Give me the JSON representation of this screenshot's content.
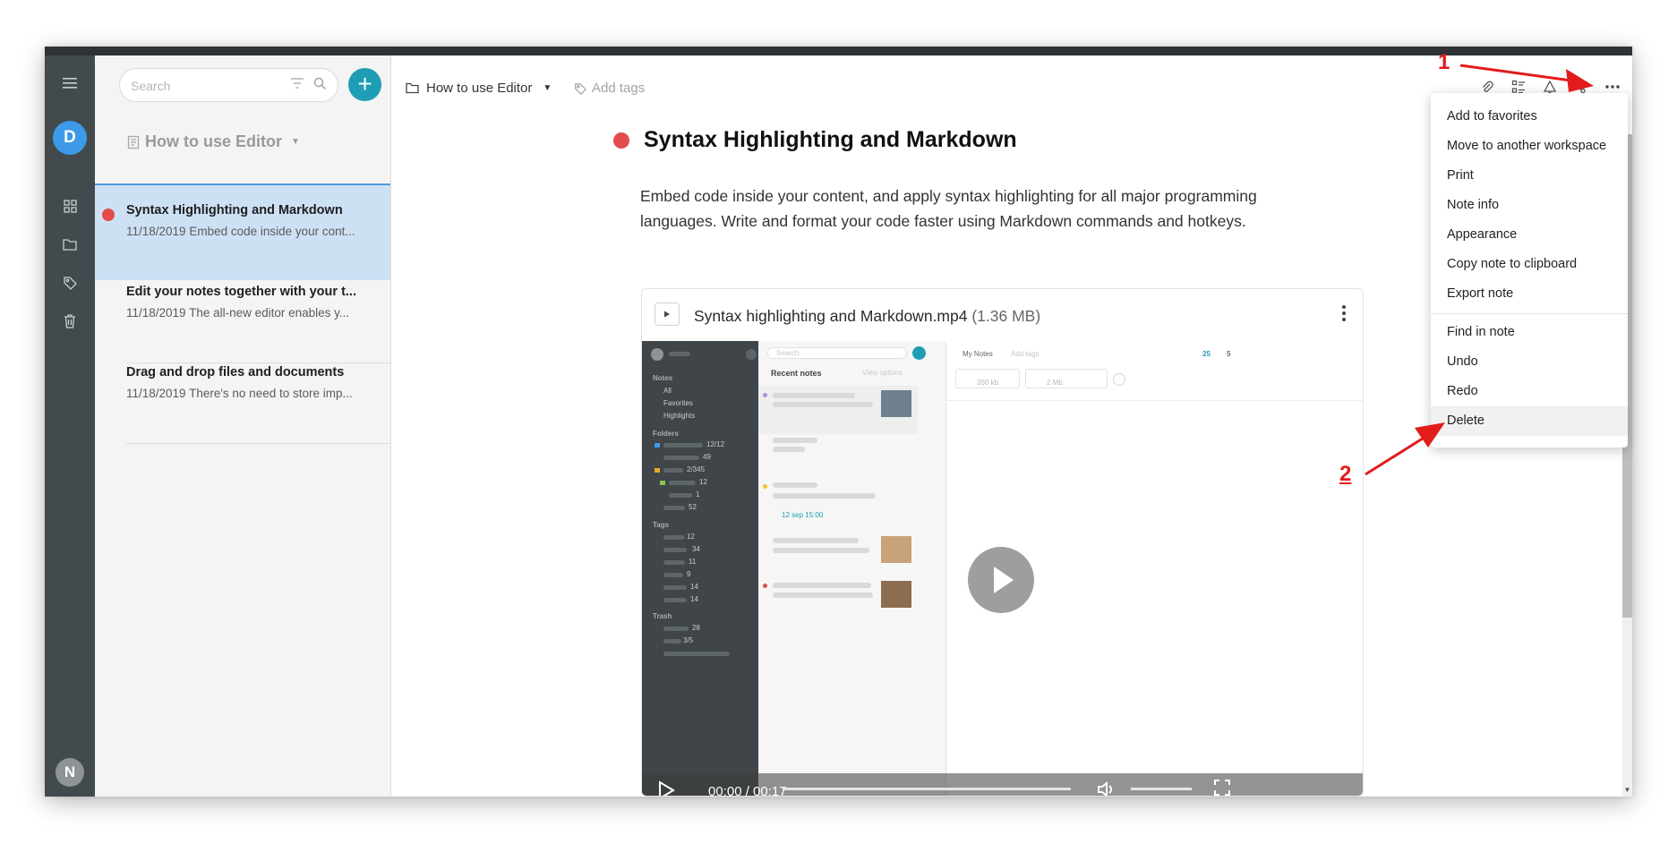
{
  "notelist": {
    "search_placeholder": "Search",
    "notebook_title": "How to use Editor",
    "notes": [
      {
        "title": "Syntax Highlighting and Markdown",
        "subtitle": "11/18/2019 Embed code inside your cont..."
      },
      {
        "title": "Edit your notes together with your t...",
        "subtitle": "11/18/2019 The all-new editor enables y..."
      },
      {
        "title": "Drag and drop files and documents",
        "subtitle": "11/18/2019 There's no need to store imp..."
      }
    ]
  },
  "rail": {
    "avatar_top": "D",
    "avatar_bottom": "N"
  },
  "editor": {
    "breadcrumb": "How to use Editor",
    "add_tags": "Add tags",
    "title": "Syntax Highlighting and Markdown",
    "body": "Embed code inside your content, and apply syntax highlighting for all major programming languages. Write and format your code faster using Markdown commands and hotkeys."
  },
  "attachment": {
    "file_name": "Syntax highlighting and Markdown.mp4",
    "file_size": "(1.36 MB)",
    "time": "00:00 / 00:17",
    "preview": {
      "search": "Search",
      "recent_notes": "Recent notes",
      "view_options": "View options",
      "my_notes": "My Notes",
      "add_tags": "Add tags",
      "notes_heading": "Notes",
      "all": "All",
      "favorites": "Favorites",
      "highlights": "Highlights",
      "folders_heading": "Folders",
      "tags_heading": "Tags",
      "trash_heading": "Trash",
      "count_a": "25",
      "count_b": "5",
      "file_a_size": "350 kb",
      "file_b_size": "2 Mb",
      "reminder": "12 sep 15:00",
      "folder_counts": [
        "12/12",
        "49",
        "2/345",
        "12",
        "1",
        "52"
      ],
      "tag_counts": [
        "12",
        "34",
        "11",
        "9",
        "14",
        "14"
      ],
      "trash_counts": [
        "28",
        "3/5"
      ]
    }
  },
  "menu": {
    "items_group1": [
      "Add to favorites",
      "Move to another workspace",
      "Print",
      "Note info",
      "Appearance",
      "Copy note to clipboard",
      "Export note"
    ],
    "items_group2": [
      "Find in note",
      "Undo",
      "Redo",
      "Delete"
    ]
  },
  "annotations": {
    "label_1": "1",
    "label_2": "2",
    "color": "#e31b1b"
  },
  "colors": {
    "accent": "#1e9db5",
    "selected_note_bg": "#cde1f5",
    "note_dot": "#e34c4c",
    "rail": "#424a4d"
  }
}
